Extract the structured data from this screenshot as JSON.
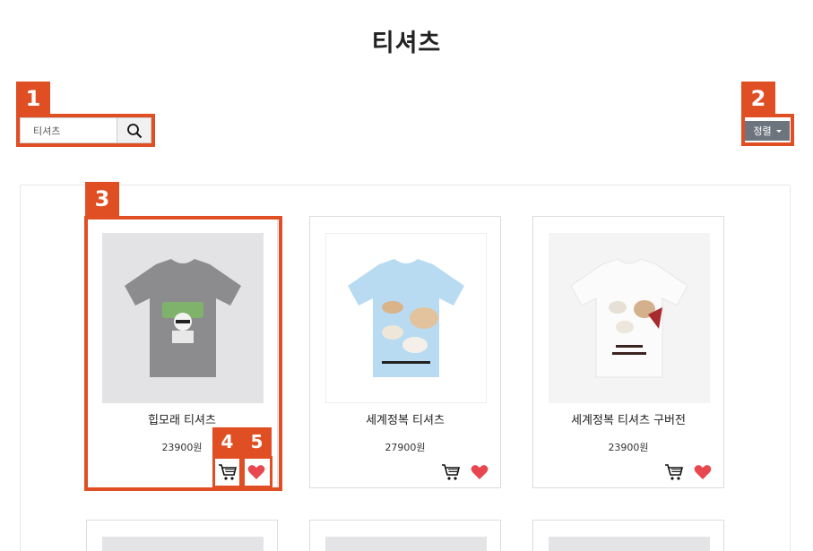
{
  "page": {
    "title": "티셔츠"
  },
  "search": {
    "value": "티셔츠",
    "icon": "search-icon"
  },
  "sort": {
    "label": "정렬",
    "icon": "caret-down-icon"
  },
  "annotations": [
    "1",
    "2",
    "3",
    "4",
    "5"
  ],
  "products": [
    {
      "name": "힙모래 티셔츠",
      "price": "23900원",
      "shirt_color": "#8c8c8e",
      "bg_color": "#e3e3e5"
    },
    {
      "name": "세계정복 티셔츠",
      "price": "27900원",
      "shirt_color": "#b8dbf2",
      "bg_color": "#ffffff"
    },
    {
      "name": "세계정복 티셔츠 구버전",
      "price": "23900원",
      "shirt_color": "#fafafa",
      "bg_color": "#f4f4f4"
    }
  ],
  "colors": {
    "accent": "#e04e23",
    "heart": "#e8474f",
    "sort_bg": "#6c757d"
  }
}
